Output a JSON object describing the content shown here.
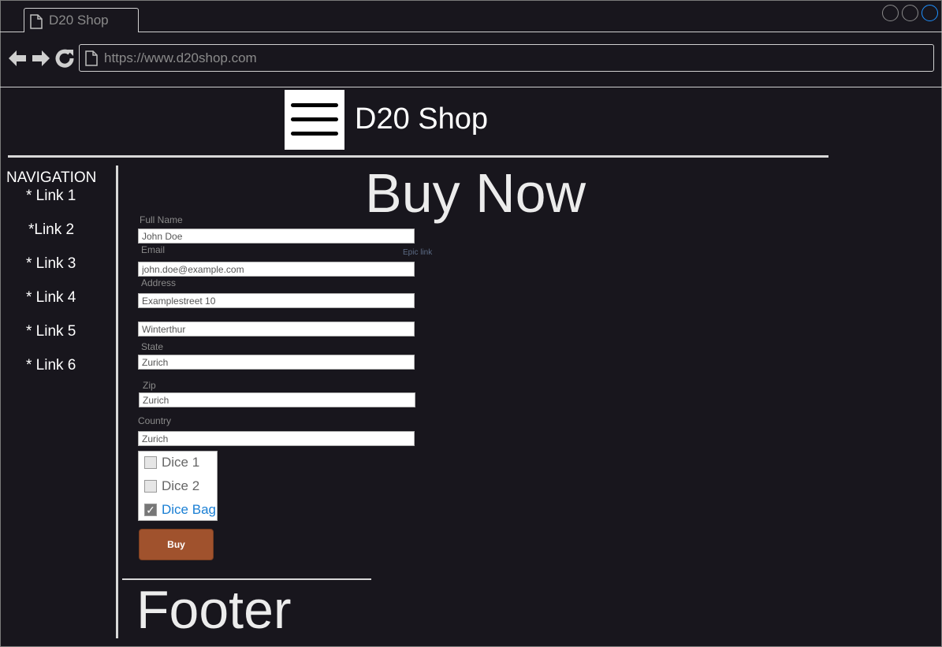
{
  "browser": {
    "tab_title": "D20 Shop",
    "url": "https://www.d20shop.com",
    "icons": {
      "back": "arrow-left-icon",
      "forward": "arrow-right-icon",
      "reload": "reload-icon",
      "page": "page-icon"
    }
  },
  "header": {
    "site_title": "D20 Shop",
    "menu_icon": "hamburger-icon"
  },
  "sidebar": {
    "heading": "NAVIGATION",
    "links": [
      "* Link 1",
      "*Link 2",
      "* Link 3",
      "* Link 4",
      "* Link 5",
      "* Link 6"
    ]
  },
  "main": {
    "heading": "Buy Now",
    "epic_link": "Epic link",
    "form": {
      "full_name_label": "Full Name",
      "full_name_value": "John Doe",
      "email_label": "Email",
      "email_value": "john.doe@example.com",
      "address_label": "Address",
      "address_value": "Examplestreet 10",
      "city_value": "Winterthur",
      "state_label": "State",
      "state_value": "Zurich",
      "zip_label": "Zip",
      "zip_value": "Zurich",
      "country_label": "Country",
      "country_value": "Zurich"
    },
    "products": [
      {
        "label": "Dice 1",
        "checked": false
      },
      {
        "label": "Dice 2",
        "checked": false
      },
      {
        "label": "Dice Bag",
        "checked": true
      }
    ],
    "buy_label": "Buy"
  },
  "footer": {
    "text": "Footer"
  },
  "colors": {
    "background": "#18161d",
    "buy_button": "#a0522d",
    "checked_label": "#1a7fd4",
    "close_control": "#1e90ff"
  }
}
